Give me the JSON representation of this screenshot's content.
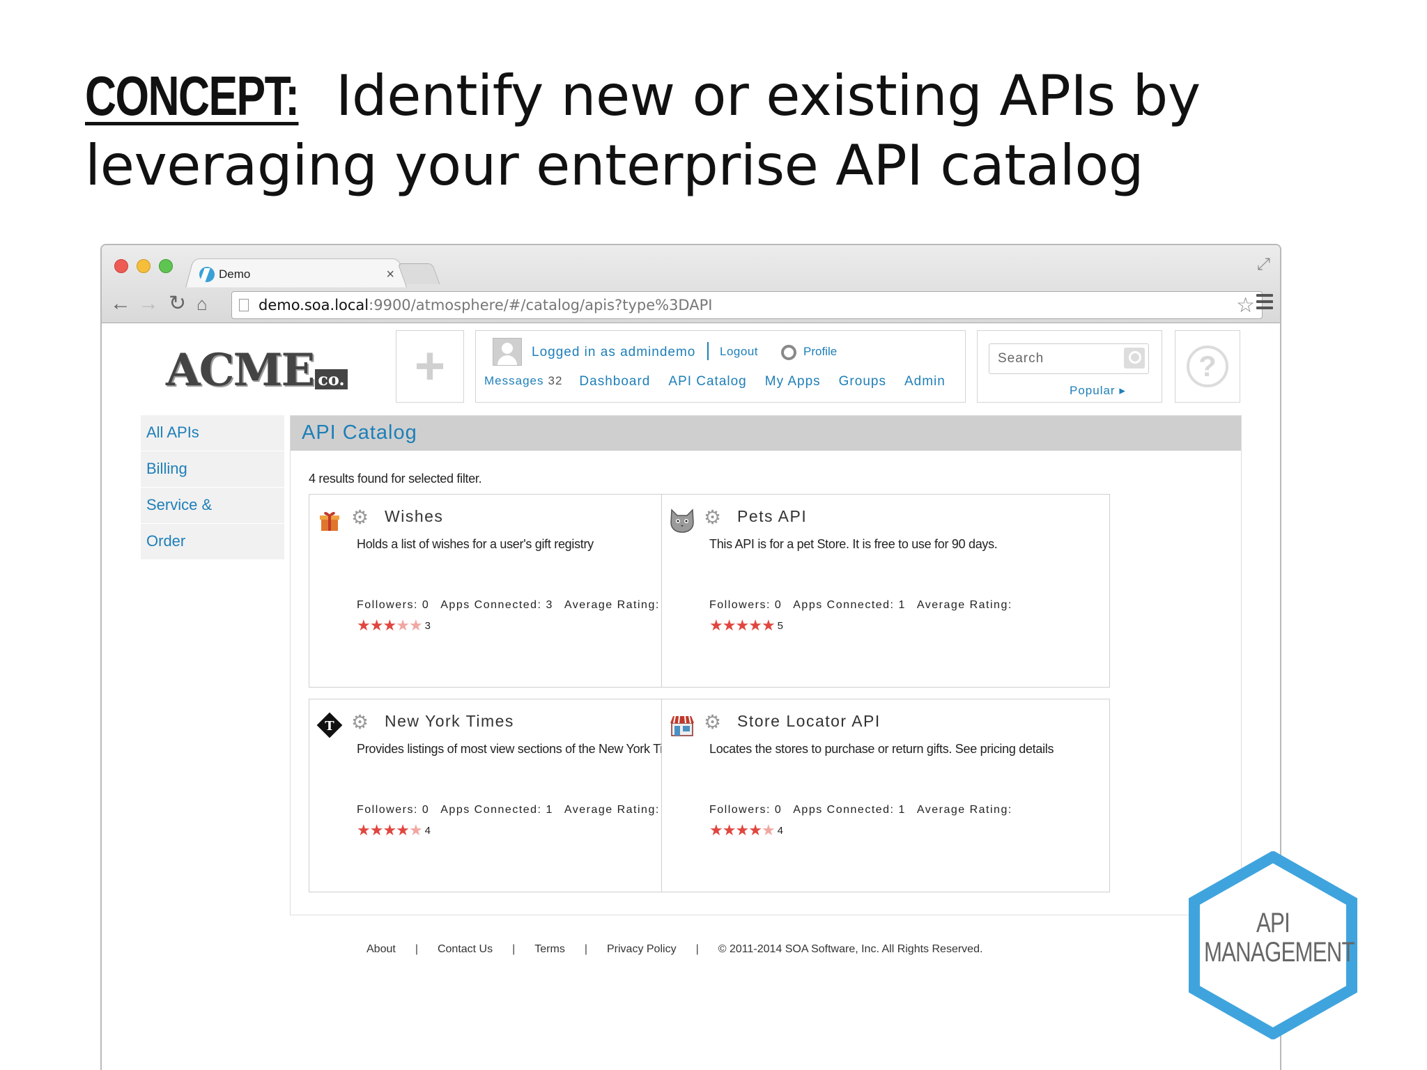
{
  "slide": {
    "concept_label": "CONCEPT:",
    "title_rest": " Identify new or existing APIs by leveraging your enterprise API catalog"
  },
  "browser": {
    "tab_title": "Demo",
    "tab_close": "×",
    "url_host": "demo.soa.local",
    "url_path": ":9900/atmosphere/#/catalog/apis?type%3DAPI"
  },
  "header": {
    "logo_text": "ACME",
    "logo_co": "co.",
    "login_text": "Logged in as admindemo",
    "logout_label": "Logout",
    "profile_label": "Profile",
    "messages_label": "Messages",
    "messages_count": "32",
    "nav": [
      "Dashboard",
      "API Catalog",
      "My Apps",
      "Groups",
      "Admin"
    ],
    "search_placeholder": "Search",
    "popular_label": "Popular ▸"
  },
  "sidebar": {
    "items": [
      "All APIs",
      "Billing",
      "Service &",
      "Order"
    ]
  },
  "catalog": {
    "heading": "API Catalog",
    "results_text": "4 results found for selected filter.",
    "cards": [
      {
        "title": "Wishes",
        "description": "Holds a list of wishes for a user's gift registry",
        "followers": "Followers: 0",
        "apps": "Apps Connected: 3",
        "rating_label": "Average Rating:",
        "rating": 3,
        "rating_text": "3",
        "icon": "gift-icon"
      },
      {
        "title": "Pets API",
        "description": "This API is for a pet Store. It is free to use for 90 days.",
        "followers": "Followers: 0",
        "apps": "Apps Connected: 1",
        "rating_label": "Average Rating:",
        "rating": 5,
        "rating_text": "5",
        "icon": "cat-icon"
      },
      {
        "title": "New York Times",
        "description": "Provides listings of most view sections of the New York Times",
        "followers": "Followers: 0",
        "apps": "Apps Connected: 1",
        "rating_label": "Average Rating:",
        "rating": 4,
        "rating_text": "4",
        "icon": "nyt-icon"
      },
      {
        "title": "Store Locator API",
        "description": "Locates the stores to purchase or return gifts. See pricing details",
        "followers": "Followers: 0",
        "apps": "Apps Connected: 1",
        "rating_label": "Average Rating:",
        "rating": 4,
        "rating_text": "4",
        "icon": "store-icon"
      }
    ]
  },
  "footer": {
    "links": [
      "About",
      "Contact Us",
      "Terms",
      "Privacy Policy"
    ],
    "separator": "|",
    "copyright": "© 2011-2014 SOA Software, Inc. All Rights Reserved."
  },
  "badge": {
    "line1": "API",
    "line2": "MANAGEMENT"
  },
  "colors": {
    "link_blue": "#1e7fb8",
    "star_red": "#e0463f",
    "badge_blue": "#3fa4dd"
  }
}
